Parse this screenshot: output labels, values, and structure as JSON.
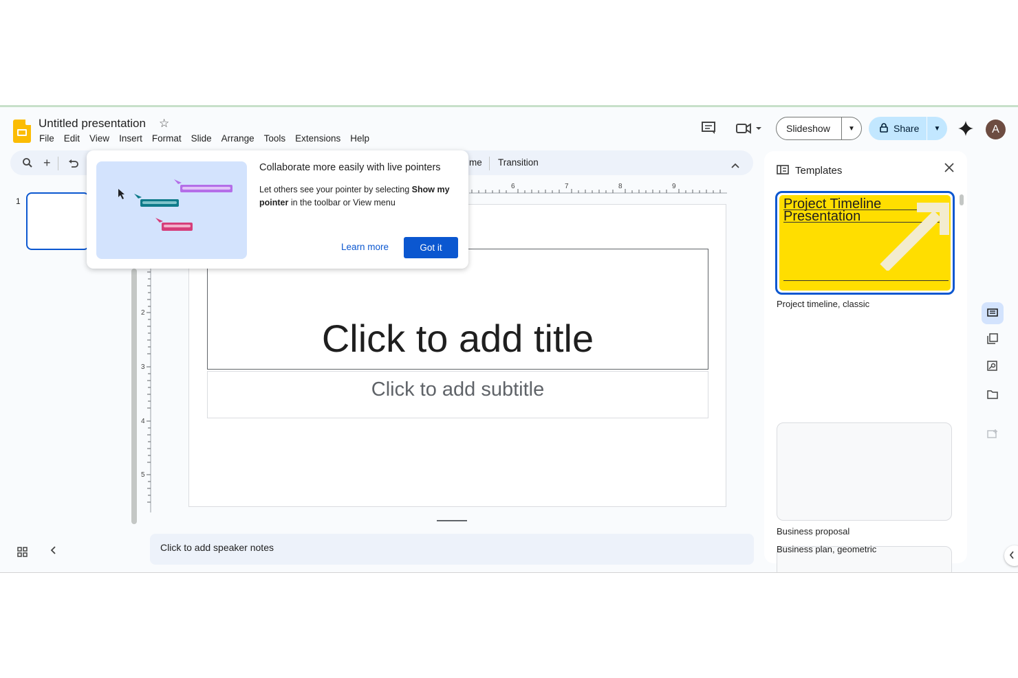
{
  "header": {
    "doc_title": "Untitled presentation",
    "menu": [
      "File",
      "Edit",
      "View",
      "Insert",
      "Format",
      "Slide",
      "Arrange",
      "Tools",
      "Extensions",
      "Help"
    ],
    "slideshow_label": "Slideshow",
    "share_label": "Share",
    "avatar_initial": "A"
  },
  "toolbar": {
    "theme_partial": "me",
    "transition_label": "Transition"
  },
  "filmstrip": {
    "slide_number": "1"
  },
  "ruler": {
    "horizontal_ticks": [
      "6",
      "7",
      "8",
      "9"
    ],
    "vertical_ticks": [
      "2",
      "3",
      "4",
      "5"
    ]
  },
  "slide": {
    "title_placeholder": "Click to add title",
    "subtitle_placeholder": "Click to add subtitle"
  },
  "notes": {
    "placeholder": "Click to add speaker notes"
  },
  "popup": {
    "title": "Collaborate more easily with live pointers",
    "body_1": "Let others see your pointer by selecting ",
    "body_bold": "Show my pointer",
    "body_2": " in the toolbar or View menu",
    "learn_more": "Learn more",
    "got_it": "Got it"
  },
  "templates": {
    "panel_title": "Templates",
    "preview_title_line1": "Project Timeline",
    "preview_title_line2": "Presentation",
    "items": [
      {
        "name": "Project timeline, classic"
      },
      {
        "name": "Business proposal"
      },
      {
        "name": "Business plan, geometric"
      }
    ]
  },
  "colors": {
    "accent": "#0b57d0",
    "share_bg": "#c2e7ff",
    "logo": "#fbbc04",
    "template_yellow": "#ffde00"
  }
}
